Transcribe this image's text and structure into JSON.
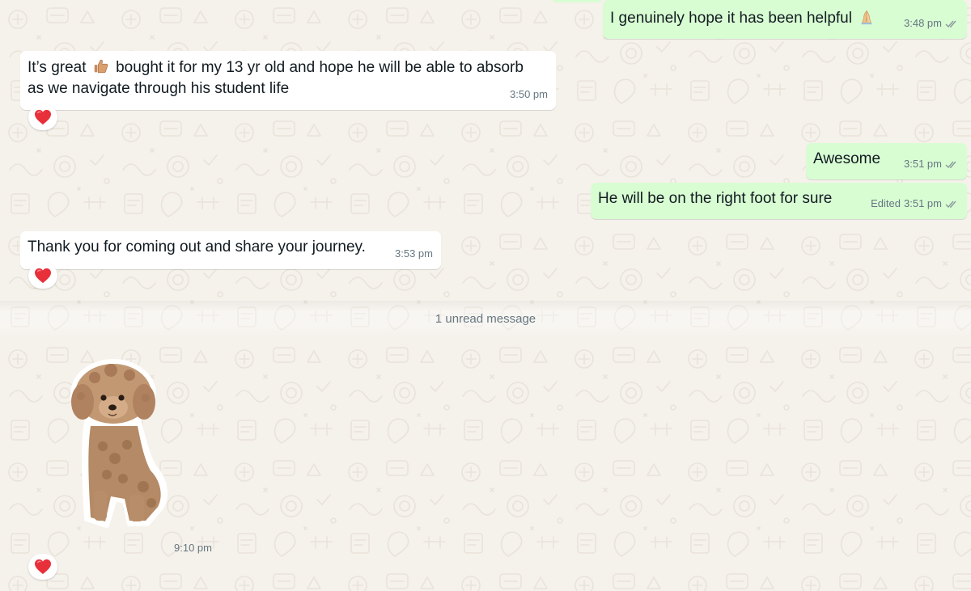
{
  "chat": {
    "messages": [
      {
        "direction": "outgoing",
        "text": "I genuinely hope it has been helpful",
        "emoji": "folded-hands",
        "time": "3:48 pm",
        "status": "read"
      },
      {
        "direction": "incoming",
        "text_before_emoji": "It’s great",
        "emoji": "thumbs-up",
        "text_after_emoji": "bought it for my 13 yr old and hope he will be able to absorb",
        "text_line2": "as we navigate through his student life",
        "time": "3:50 pm",
        "reaction": "red-heart"
      },
      {
        "direction": "outgoing",
        "text": "Awesome",
        "time": "3:51 pm",
        "status": "read"
      },
      {
        "direction": "outgoing",
        "text": "He will be on the right foot for sure",
        "edited_label": "Edited",
        "time": "3:51 pm",
        "status": "read"
      },
      {
        "direction": "incoming",
        "text": "Thank you for coming out and share your journey.",
        "time": "3:53 pm",
        "reaction": "red-heart"
      }
    ],
    "unread_divider": "1 unread message",
    "sticker_message": {
      "direction": "incoming",
      "sticker": "poodle-dog",
      "time": "9:10 pm",
      "reaction": "red-heart"
    }
  },
  "colors": {
    "background": "#f5f1eb",
    "incoming_bubble": "#ffffff",
    "outgoing_bubble": "#d9fdd3",
    "meta_text": "#667781",
    "read_ticks": "#8a9a9c",
    "heart": "#e8303b"
  }
}
